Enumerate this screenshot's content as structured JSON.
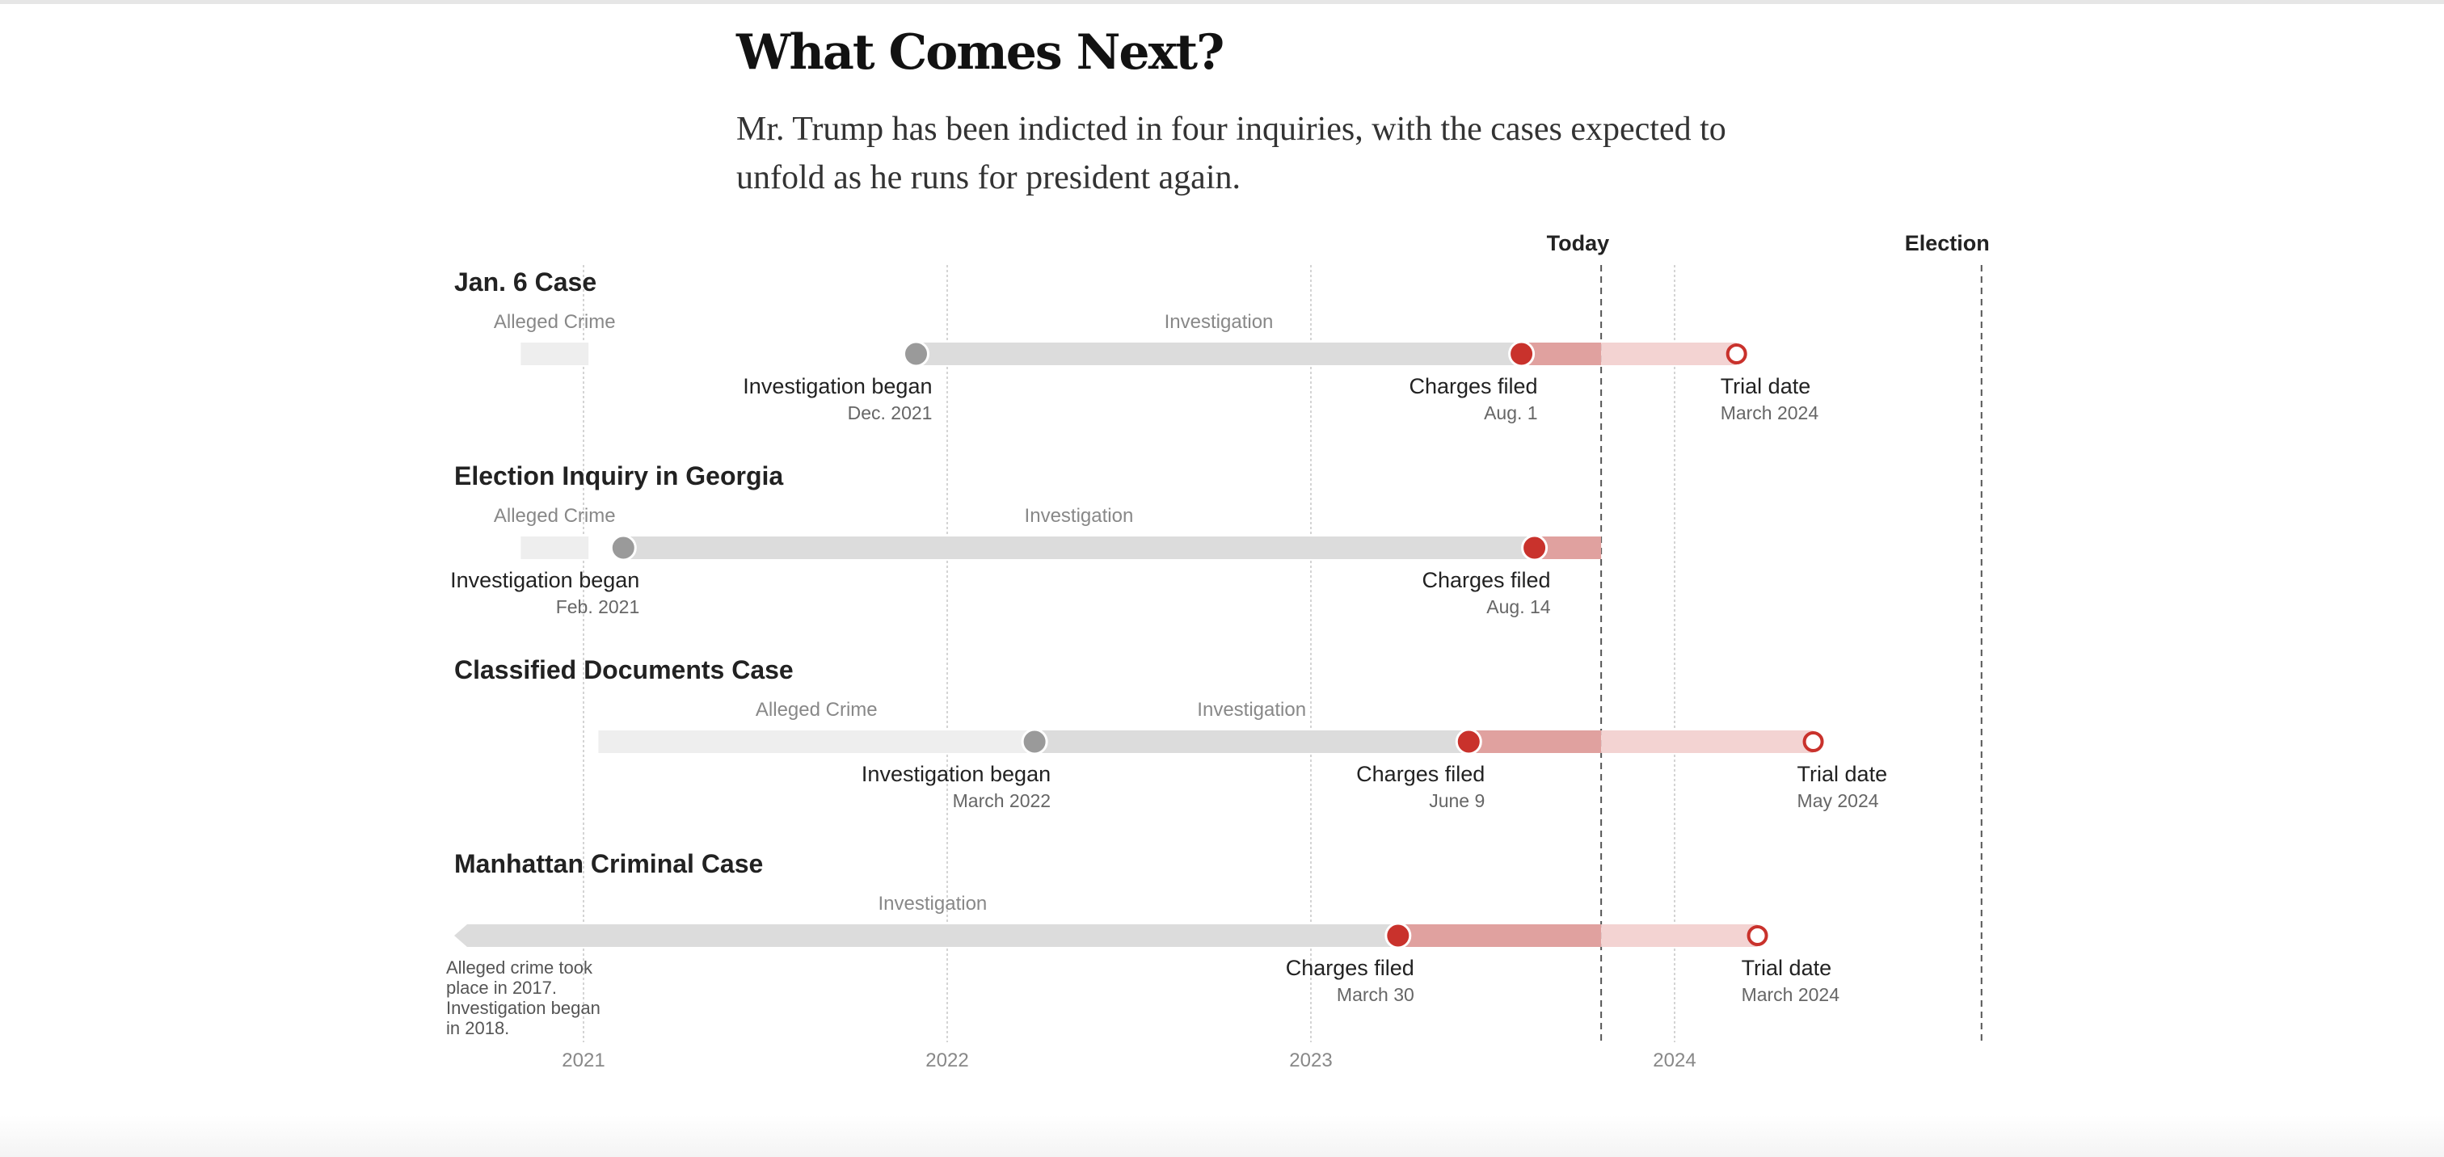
{
  "header": {
    "title": "What Comes Next?",
    "dek": "Mr. Trump has been indicted in four inquiries, with the cases expected to unfold as he runs for president again."
  },
  "colors": {
    "alleged_crime": "#eeeeee",
    "investigation": "#dcdcdc",
    "post_charge": "#e0a19f",
    "pre_trial": "#f3d3d2",
    "charges_dot": "#c9322c",
    "investigation_dot": "#9a9a9a",
    "gridline": "#d4d4d4",
    "marker_line": "#555555"
  },
  "chart_data": {
    "type": "timeline",
    "x_axis": {
      "ticks": [
        "2021",
        "2022",
        "2023",
        "2024"
      ]
    },
    "markers": [
      {
        "label": "Today",
        "date": "2023-10-20"
      },
      {
        "label": "Election",
        "date": "2024-11-05"
      }
    ],
    "cases": [
      {
        "name": "Jan. 6 Case",
        "crime": {
          "label": "Alleged Crime",
          "start": "2020-11-03",
          "end": "2021-01-06"
        },
        "investigation": {
          "label": "Investigation",
          "start": "2021-12-01",
          "end": "2023-08-01"
        },
        "events": [
          {
            "type": "investigation",
            "label": "Investigation began",
            "date_label": "Dec. 2021",
            "date": "2021-12-01"
          },
          {
            "type": "charges",
            "label": "Charges filed",
            "date_label": "Aug. 1",
            "date": "2023-08-01"
          },
          {
            "type": "trial",
            "label": "Trial date",
            "date_label": "March 2024",
            "date": "2024-03-04"
          }
        ]
      },
      {
        "name": "Election Inquiry in Georgia",
        "crime": {
          "label": "Alleged Crime",
          "start": "2020-11-03",
          "end": "2021-01-06"
        },
        "investigation": {
          "label": "Investigation",
          "start": "2021-02-10",
          "end": "2023-08-14"
        },
        "events": [
          {
            "type": "investigation",
            "label": "Investigation began",
            "date_label": "Feb. 2021",
            "date": "2021-02-10"
          },
          {
            "type": "charges",
            "label": "Charges filed",
            "date_label": "Aug. 14",
            "date": "2023-08-14"
          }
        ]
      },
      {
        "name": "Classified Documents Case",
        "crime": {
          "label": "Alleged Crime",
          "start": "2021-01-20",
          "end": "2022-03-30"
        },
        "investigation": {
          "label": "Investigation",
          "start": "2022-03-30",
          "end": "2023-06-09"
        },
        "events": [
          {
            "type": "investigation",
            "label": "Investigation began",
            "date_label": "March 2022",
            "date": "2022-03-30"
          },
          {
            "type": "charges",
            "label": "Charges filed",
            "date_label": "June 9",
            "date": "2023-06-09"
          },
          {
            "type": "trial",
            "label": "Trial date",
            "date_label": "May 2024",
            "date": "2024-05-20"
          }
        ]
      },
      {
        "name": "Manhattan Criminal Case",
        "investigation": {
          "label": "Investigation",
          "end": "2023-03-30",
          "continues_left": true
        },
        "note": [
          "Alleged crime took",
          "place in 2017.",
          "Investigation began",
          "in 2018."
        ],
        "events": [
          {
            "type": "charges",
            "label": "Charges filed",
            "date_label": "March 30",
            "date": "2023-03-30"
          },
          {
            "type": "trial",
            "label": "Trial date",
            "date_label": "March 2024",
            "date": "2024-03-25"
          }
        ]
      }
    ]
  }
}
